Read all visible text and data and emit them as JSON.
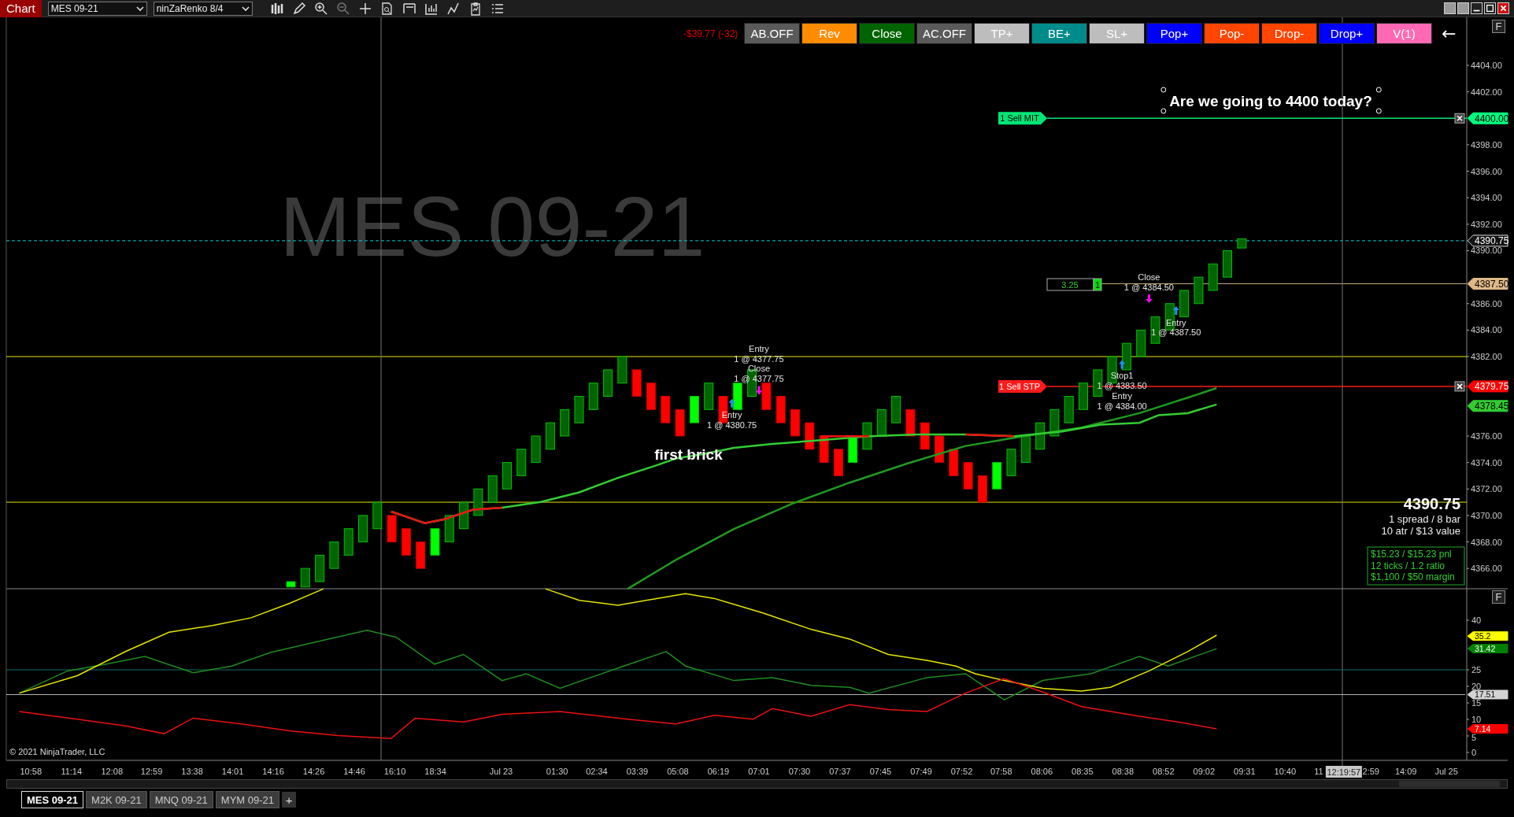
{
  "header": {
    "title": "Chart",
    "instrument": "MES 09-21",
    "bar_type": "ninZaRenko 8/4"
  },
  "chart": {
    "pnl": "-$39.77 (-32)",
    "toolbar_buttons": [
      {
        "label": "AB.OFF",
        "color": "#5a5a5a"
      },
      {
        "label": "Rev",
        "color": "#ff8c00"
      },
      {
        "label": "Close",
        "color": "#006400"
      },
      {
        "label": "AC.OFF",
        "color": "#5a5a5a"
      },
      {
        "label": "TP+",
        "color": "#bdbdbd"
      },
      {
        "label": "BE+",
        "color": "#008b8b"
      },
      {
        "label": "SL+",
        "color": "#bdbdbd"
      },
      {
        "label": "Pop+",
        "color": "#0000ff"
      },
      {
        "label": "Pop-",
        "color": "#ff4500"
      },
      {
        "label": "Drop-",
        "color": "#ff4500"
      },
      {
        "label": "Drop+",
        "color": "#0000ff"
      },
      {
        "label": "V(1)",
        "color": "#ff69b4"
      }
    ],
    "back_arrow": "←",
    "panel_buttons": [
      "F",
      "F"
    ],
    "instrument_label": "MES 09-21",
    "note": "Are we going to 4400 today?",
    "brick_note": "first brick",
    "orders": [
      {
        "label": "1 Sell MIT",
        "color": "#00e676"
      },
      {
        "label": "1 Sell STP",
        "color": "#ff1a1a"
      }
    ],
    "executions": [
      {
        "action": "Entry",
        "detail": "1 @ 4377.75"
      },
      {
        "action": "Close",
        "detail": "1 @ 4377.75"
      },
      {
        "action": "Entry",
        "detail": "1 @ 4380.75"
      },
      {
        "action": "Close",
        "detail": "1 @ 4384.50"
      },
      {
        "action": "Entry",
        "detail": "1 @ 4387.50"
      },
      {
        "action": "Stop1",
        "detail": "1 @ 4383.50"
      },
      {
        "action": "Entry",
        "detail": "1 @ 4384.00"
      }
    ],
    "position_box": {
      "points": "3.25",
      "quantity": "1"
    },
    "info": {
      "price": "4390.75",
      "lines": [
        "1 spread / 8 bar",
        "10 atr / $13 value"
      ],
      "stats": [
        "$15.23 / $15.23 pnl",
        "12 ticks / 1.2 ratio",
        "$1,100 / $50 margin"
      ]
    },
    "price_axis": [
      "4404.00",
      "4402.00",
      "4398.00",
      "4396.00",
      "4394.00",
      "4392.00",
      "4390.00",
      "4386.00",
      "4384.00",
      "4382.00",
      "4376.00",
      "4374.00",
      "4372.00",
      "4370.00",
      "4368.00",
      "4366.00"
    ],
    "price_badges": [
      {
        "text": "4400.00",
        "color": "#00ff80"
      },
      {
        "text": "4390.75",
        "color": "#141414"
      },
      {
        "text": "4387.50",
        "color": "#deb887"
      },
      {
        "text": "4379.75",
        "color": "#ff0000"
      },
      {
        "text": "4378.45",
        "color": "#32cd32"
      }
    ],
    "indicator_axis": [
      "40",
      "25",
      "20",
      "15",
      "10",
      "5",
      "0"
    ],
    "indicator_badges": [
      {
        "text": "35.2",
        "color": "#ffff00"
      },
      {
        "text": "31.42",
        "color": "#008000"
      },
      {
        "text": "17.51",
        "color": "#d3d3d3"
      },
      {
        "text": "7.14",
        "color": "#ff0000"
      }
    ],
    "copyright": "© 2021 NinjaTrader, LLC",
    "time_axis": [
      "10:58",
      "11:14",
      "12:08",
      "12:59",
      "13:38",
      "14:01",
      "14:16",
      "14:26",
      "14:46",
      "16:10",
      "18:34",
      "Jul 23",
      "01:30",
      "02:34",
      "03:39",
      "05:08",
      "06:19",
      "07:01",
      "07:30",
      "07:37",
      "07:45",
      "07:49",
      "07:52",
      "07:58",
      "08:06",
      "08:35",
      "08:38",
      "08:52",
      "09:02",
      "09:31",
      "10:40",
      "11",
      "2:59",
      "14:09",
      "Jul 25"
    ],
    "crosshair_time": "12:19:57"
  },
  "tabs": [
    {
      "label": "MES 09-21",
      "selected": true
    },
    {
      "label": "M2K 09-21",
      "selected": false
    },
    {
      "label": "MNQ 09-21",
      "selected": false
    },
    {
      "label": "MYM 09-21",
      "selected": false
    }
  ],
  "add_tab": "+"
}
